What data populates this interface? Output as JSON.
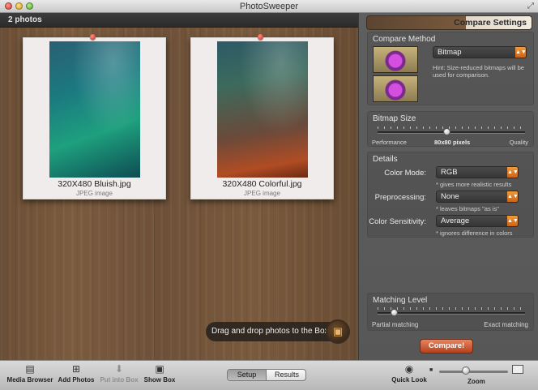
{
  "app": {
    "title": "PhotoSweeper"
  },
  "board": {
    "photo_count": "2 photos",
    "photos": [
      {
        "name": "320X480 Bluish.jpg",
        "type": "JPEG image"
      },
      {
        "name": "320X480 Colorful.jpg",
        "type": "JPEG image"
      }
    ],
    "drop_hint": "Drag and drop photos to the Box"
  },
  "settings": {
    "tab_label": "Compare Settings",
    "compare_method": {
      "title": "Compare Method",
      "selected": "Bitmap",
      "hint": "Hint: Size-reduced bitmaps will be used for comparison."
    },
    "bitmap_size": {
      "title": "Bitmap Size",
      "left_label": "Performance",
      "value": "80x80 pixels",
      "right_label": "Quality",
      "level": 0.5
    },
    "details": {
      "title": "Details",
      "color_mode_label": "Color Mode:",
      "color_mode_value": "RGB",
      "color_mode_note": "* gives more realistic results",
      "preprocessing_label": "Preprocessing:",
      "preprocessing_value": "None",
      "preprocessing_note": "* leaves bitmaps \"as is\"",
      "sensitivity_label": "Color Sensitivity:",
      "sensitivity_value": "Average",
      "sensitivity_note": "* ignores difference in colors"
    },
    "matching_level": {
      "title": "Matching Level",
      "left_label": "Partial matching",
      "right_label": "Exact matching",
      "level": 0.1
    },
    "compare_button": "Compare!"
  },
  "toolbar": {
    "media_browser": "Media Browser",
    "add_photos": "Add Photos",
    "put_into_box": "Put into Box",
    "show_box": "Show Box",
    "segments": [
      "Setup",
      "Results"
    ],
    "quick_look": "Quick Look",
    "zoom": "Zoom"
  },
  "colors": {
    "accent": "#c8641b",
    "compare_button": "#b3421f"
  }
}
